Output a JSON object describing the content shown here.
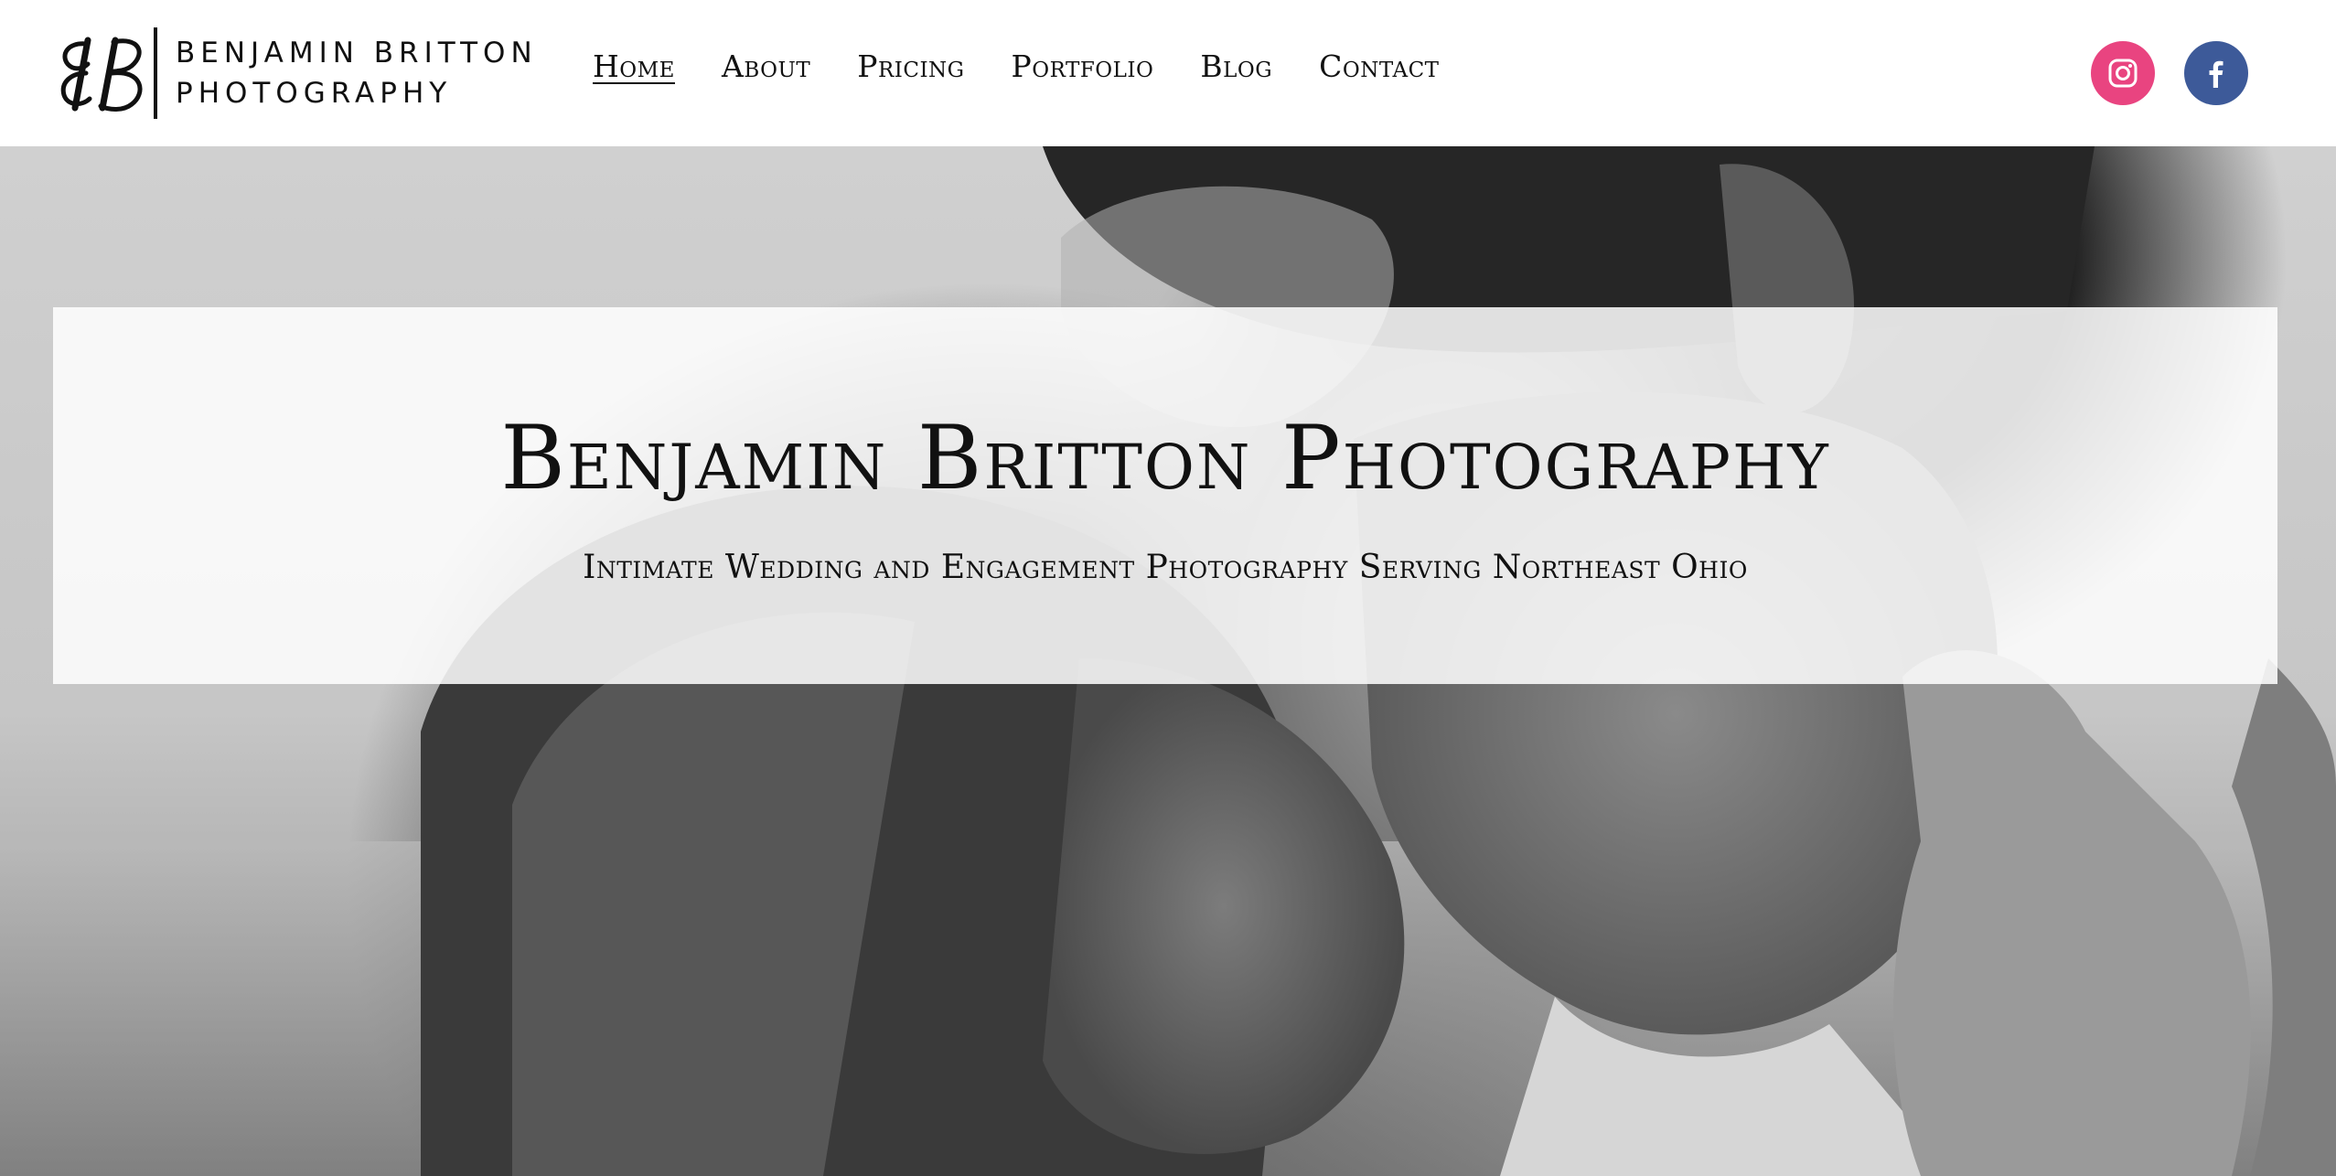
{
  "brand": {
    "monogram": "BB",
    "line1": "BENJAMIN BRITTON",
    "line2": "PHOTOGRAPHY"
  },
  "nav": {
    "items": [
      {
        "label": "Home",
        "active": true
      },
      {
        "label": "About",
        "active": false
      },
      {
        "label": "Pricing",
        "active": false
      },
      {
        "label": "Portfolio",
        "active": false
      },
      {
        "label": "Blog",
        "active": false
      },
      {
        "label": "Contact",
        "active": false
      }
    ]
  },
  "social": {
    "instagram": {
      "icon": "instagram-icon",
      "color": "#e94480"
    },
    "facebook": {
      "icon": "facebook-icon",
      "color": "#3d5a99"
    }
  },
  "hero": {
    "title": "Benjamin Britton Photography",
    "subtitle": "Intimate Wedding and Engagement Photography Serving Northeast Ohio",
    "image": "black-and-white-couple-photo"
  }
}
